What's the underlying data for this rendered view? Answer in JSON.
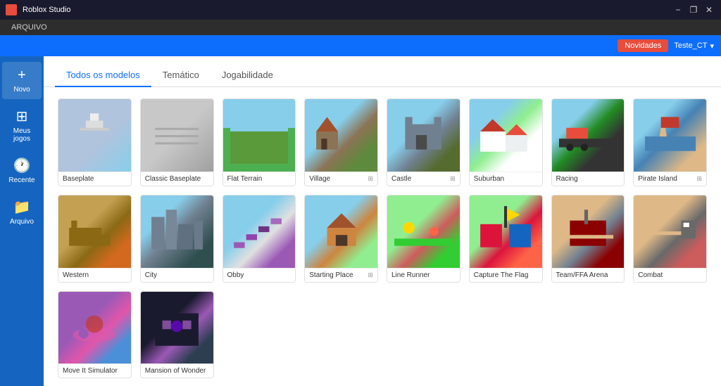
{
  "titleBar": {
    "title": "Roblox Studio",
    "minimizeLabel": "−",
    "maximizeLabel": "❐",
    "closeLabel": "✕"
  },
  "menuBar": {
    "items": [
      {
        "label": "ARQUIVO"
      }
    ]
  },
  "topBar": {
    "novidades": "Novidades",
    "user": "Teste_CT",
    "chevron": "▾"
  },
  "sidebar": {
    "items": [
      {
        "label": "Novo",
        "icon": "+"
      },
      {
        "label": "Meus jogos",
        "icon": "⊞"
      },
      {
        "label": "Recente",
        "icon": "🕐"
      },
      {
        "label": "Arquivo",
        "icon": "📁"
      }
    ]
  },
  "tabs": [
    {
      "label": "Todos os modelos",
      "active": true
    },
    {
      "label": "Temático",
      "active": false
    },
    {
      "label": "Jogabilidade",
      "active": false
    }
  ],
  "templates": [
    {
      "name": "Baseplate",
      "thumb": "baseplate",
      "hasIcon": false
    },
    {
      "name": "Classic Baseplate",
      "thumb": "classic",
      "hasIcon": false
    },
    {
      "name": "Flat Terrain",
      "thumb": "flat",
      "hasIcon": false
    },
    {
      "name": "Village",
      "thumb": "village",
      "hasIcon": true
    },
    {
      "name": "Castle",
      "thumb": "castle",
      "hasIcon": true
    },
    {
      "name": "Suburban",
      "thumb": "suburban",
      "hasIcon": false
    },
    {
      "name": "Racing",
      "thumb": "racing",
      "hasIcon": false
    },
    {
      "name": "Pirate Island",
      "thumb": "pirate",
      "hasIcon": true
    },
    {
      "name": "Western",
      "thumb": "western",
      "hasIcon": false
    },
    {
      "name": "City",
      "thumb": "city",
      "hasIcon": false
    },
    {
      "name": "Obby",
      "thumb": "obby",
      "hasIcon": false
    },
    {
      "name": "Starting Place",
      "thumb": "starting",
      "hasIcon": true
    },
    {
      "name": "Line Runner",
      "thumb": "linerunner",
      "hasIcon": false
    },
    {
      "name": "Capture The Flag",
      "thumb": "capture",
      "hasIcon": false
    },
    {
      "name": "Team/FFA Arena",
      "thumb": "teamffa",
      "hasIcon": false
    },
    {
      "name": "Combat",
      "thumb": "combat",
      "hasIcon": false
    },
    {
      "name": "Move It Simulator",
      "thumb": "moveit",
      "hasIcon": false
    },
    {
      "name": "Mansion of Wonder",
      "thumb": "mansion",
      "hasIcon": false
    }
  ]
}
